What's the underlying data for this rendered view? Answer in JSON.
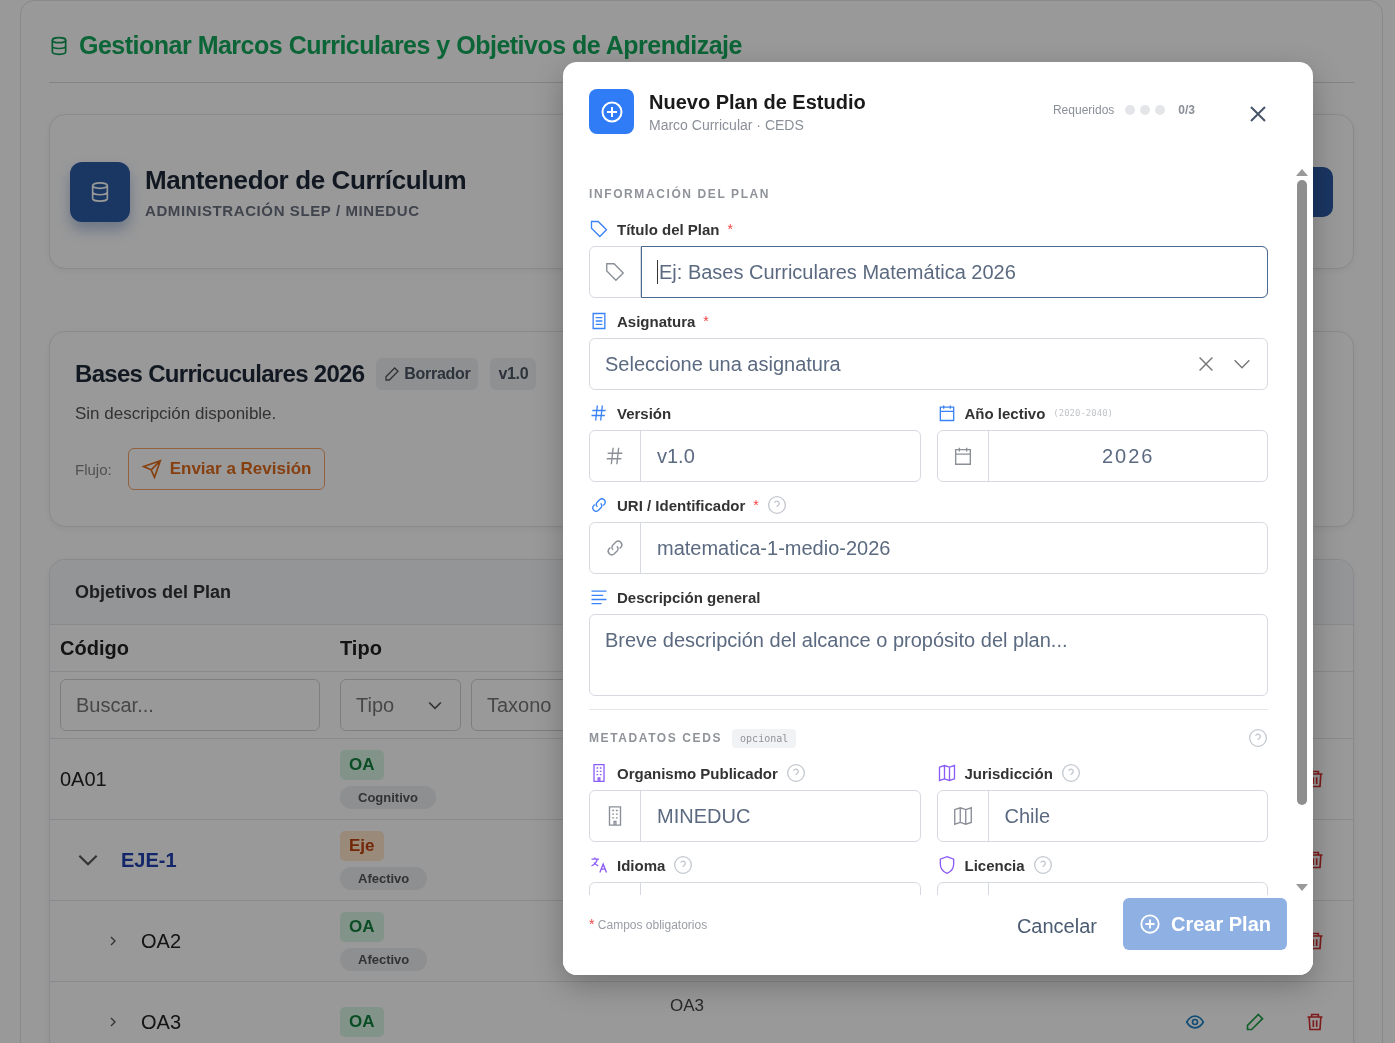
{
  "page": {
    "title": "Gestionar Marcos Curriculares y Objetivos de Aprendizaje",
    "header_card": {
      "title": "Mantenedor de Currículum",
      "subtitle": "ADMINISTRACIÓN SLEP / MINEDUC"
    },
    "plan_card": {
      "title": "Bases Curricuculares 2026",
      "status": "Borrador",
      "version": "v1.0",
      "description": "Sin descripción disponible.",
      "flow_label": "Flujo:",
      "flow_button": "Enviar a Revisión"
    },
    "objectives": {
      "title": "Objetivos del Plan",
      "columns": [
        "Código",
        "Tipo"
      ],
      "filters": [
        {
          "kind": "text",
          "placeholder": "Buscar..."
        },
        {
          "kind": "select",
          "placeholder": "Tipo"
        },
        {
          "kind": "partial",
          "placeholder": "Taxono"
        }
      ],
      "rows": [
        {
          "code": "0A01",
          "kind": "objective",
          "type": "OA",
          "domain": "Cognitivo"
        },
        {
          "code": "EJE-1",
          "kind": "axis",
          "type": "Eje",
          "domain": "Afectivo",
          "expanded": true,
          "children": [
            {
              "code": "OA2",
              "kind": "objective",
              "type": "OA",
              "domain": "Afectivo",
              "expanded": false
            },
            {
              "code": "OA3",
              "kind": "objective",
              "type": "OA",
              "column_3": "OA3",
              "expanded": false
            }
          ]
        }
      ]
    }
  },
  "modal": {
    "title": "Nuevo Plan de Estudio",
    "subtitle": "Marco Curricular · CEDS",
    "progress": {
      "label": "Requeridos",
      "steps": [
        {
          "done": false
        },
        {
          "done": false
        },
        {
          "done": false
        }
      ],
      "count": "0/3"
    },
    "sections": [
      {
        "title": "INFORMACIÓN DEL PLAN",
        "help": false,
        "rows": [
          [
            {
              "kind": "title",
              "label": "Título del Plan",
              "required": true,
              "help": false,
              "placeholder": "Ej: Bases Curriculares Matemática 2026",
              "focused": true
            }
          ],
          [
            {
              "kind": "subject",
              "label": "Asignatura",
              "required": true,
              "help": false,
              "placeholder": "Seleccione una asignatura",
              "focused": false
            }
          ],
          [
            {
              "kind": "version",
              "label": "Versión",
              "required": false,
              "help": false,
              "value": "v1.0",
              "focused": false
            },
            {
              "kind": "year",
              "label": "Año lectivo",
              "hint": "(2020-2040)",
              "required": false,
              "help": false,
              "value": "2026",
              "focused": false
            }
          ],
          [
            {
              "kind": "uri",
              "label": "URI / Identificador",
              "required": true,
              "help": true,
              "value": "matematica-1-medio-2026",
              "focused": false
            }
          ],
          [
            {
              "kind": "description",
              "label": "Descripción general",
              "required": false,
              "help": false,
              "placeholder": "Breve descripción del alcance o propósito del plan...",
              "focused": false
            }
          ]
        ]
      },
      {
        "title": "METADATOS CEDS",
        "badge": "opcional",
        "help": true,
        "rows": [
          [
            {
              "kind": "publisher",
              "label": "Organismo Publicador",
              "required": false,
              "help": true,
              "value": "MINEDUC",
              "focused": false
            },
            {
              "kind": "jurisdiction",
              "label": "Jurisdicción",
              "required": false,
              "help": true,
              "value": "Chile",
              "focused": false
            }
          ],
          [
            {
              "kind": "language",
              "label": "Idioma",
              "required": false,
              "help": true,
              "focused": false
            },
            {
              "kind": "license",
              "label": "Licencia",
              "required": false,
              "help": true,
              "focused": false
            }
          ]
        ]
      }
    ],
    "footer": {
      "required_mark": "*",
      "note": "Campos obligatorios",
      "cancel": "Cancelar",
      "submit": {
        "label": "Crear Plan",
        "disabled": true
      }
    }
  }
}
